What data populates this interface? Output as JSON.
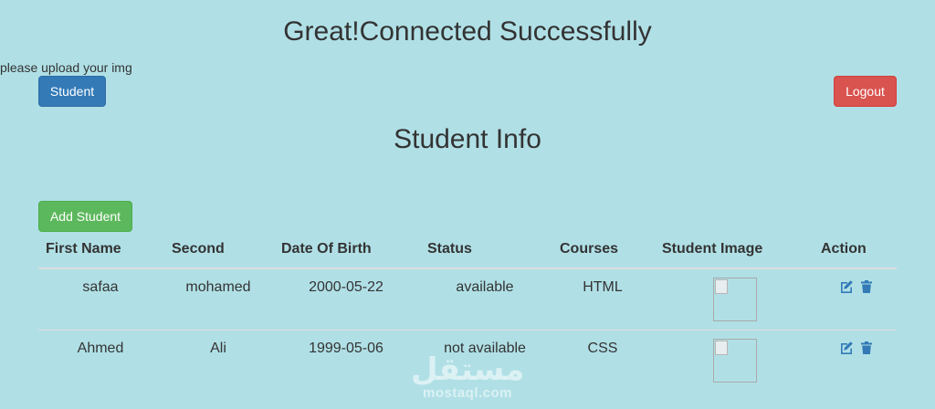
{
  "header": {
    "title": "Great!Connected Successfully",
    "upload_note": "please upload your img",
    "student_button": "Student",
    "logout_button": "Logout"
  },
  "section": {
    "title": "Student Info",
    "add_button": "Add Student"
  },
  "table": {
    "columns": [
      "First Name",
      "Second",
      "Date Of Birth",
      "Status",
      "Courses",
      "Student Image",
      "Action"
    ],
    "rows": [
      {
        "first_name": "safaa",
        "second": "mohamed",
        "dob": "2000-05-22",
        "status": "available",
        "course": "HTML"
      },
      {
        "first_name": "Ahmed",
        "second": "Ali",
        "dob": "1999-05-06",
        "status": "not available",
        "course": "CSS"
      }
    ]
  },
  "icons": {
    "edit": "edit-icon",
    "delete": "trash-icon",
    "broken_image": "broken-image-icon"
  },
  "colors": {
    "background": "#b0e0e6",
    "primary": "#337ab7",
    "danger": "#d9534f",
    "success": "#5cb85c"
  },
  "watermark": {
    "arabic": "مستقل",
    "latin": "mostaql.com"
  }
}
